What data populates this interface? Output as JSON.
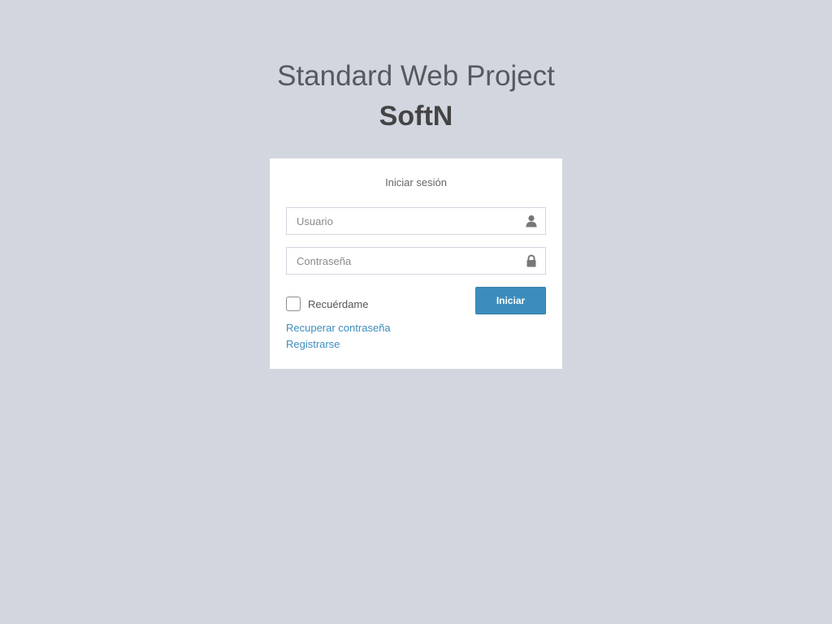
{
  "header": {
    "title": "Standard Web Project",
    "subtitle": "SoftN"
  },
  "login": {
    "message": "Iniciar sesión",
    "username": {
      "placeholder": "Usuario",
      "value": "",
      "icon": "user-icon"
    },
    "password": {
      "placeholder": "Contraseña",
      "value": "",
      "icon": "lock-icon"
    },
    "remember_label": "Recuérdame",
    "remember_checked": false,
    "submit_label": "Iniciar",
    "recover_link": "Recuperar contraseña",
    "register_link": "Registrarse"
  },
  "colors": {
    "background": "#d2d6de",
    "primary": "#3c8dbc",
    "box": "#ffffff"
  }
}
